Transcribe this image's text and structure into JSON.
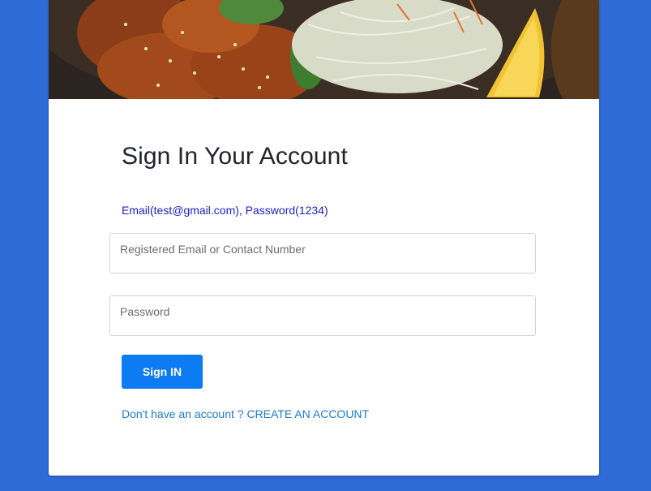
{
  "hero": {
    "image_name": "food-plate-image"
  },
  "login": {
    "title": "Sign In Your Account",
    "hint": "Email(test@gmail.com), Password(1234)",
    "email_placeholder": "Registered Email or Contact Number",
    "password_placeholder": "Password",
    "submit_label": "Sign IN",
    "signup_link": "Don't have an account ? CREATE AN ACCOUNT"
  },
  "colors": {
    "background": "#2f6bd6",
    "button": "#0d7bf2",
    "hint_text": "#1a1fc4",
    "link_text": "#1a7bd1"
  }
}
